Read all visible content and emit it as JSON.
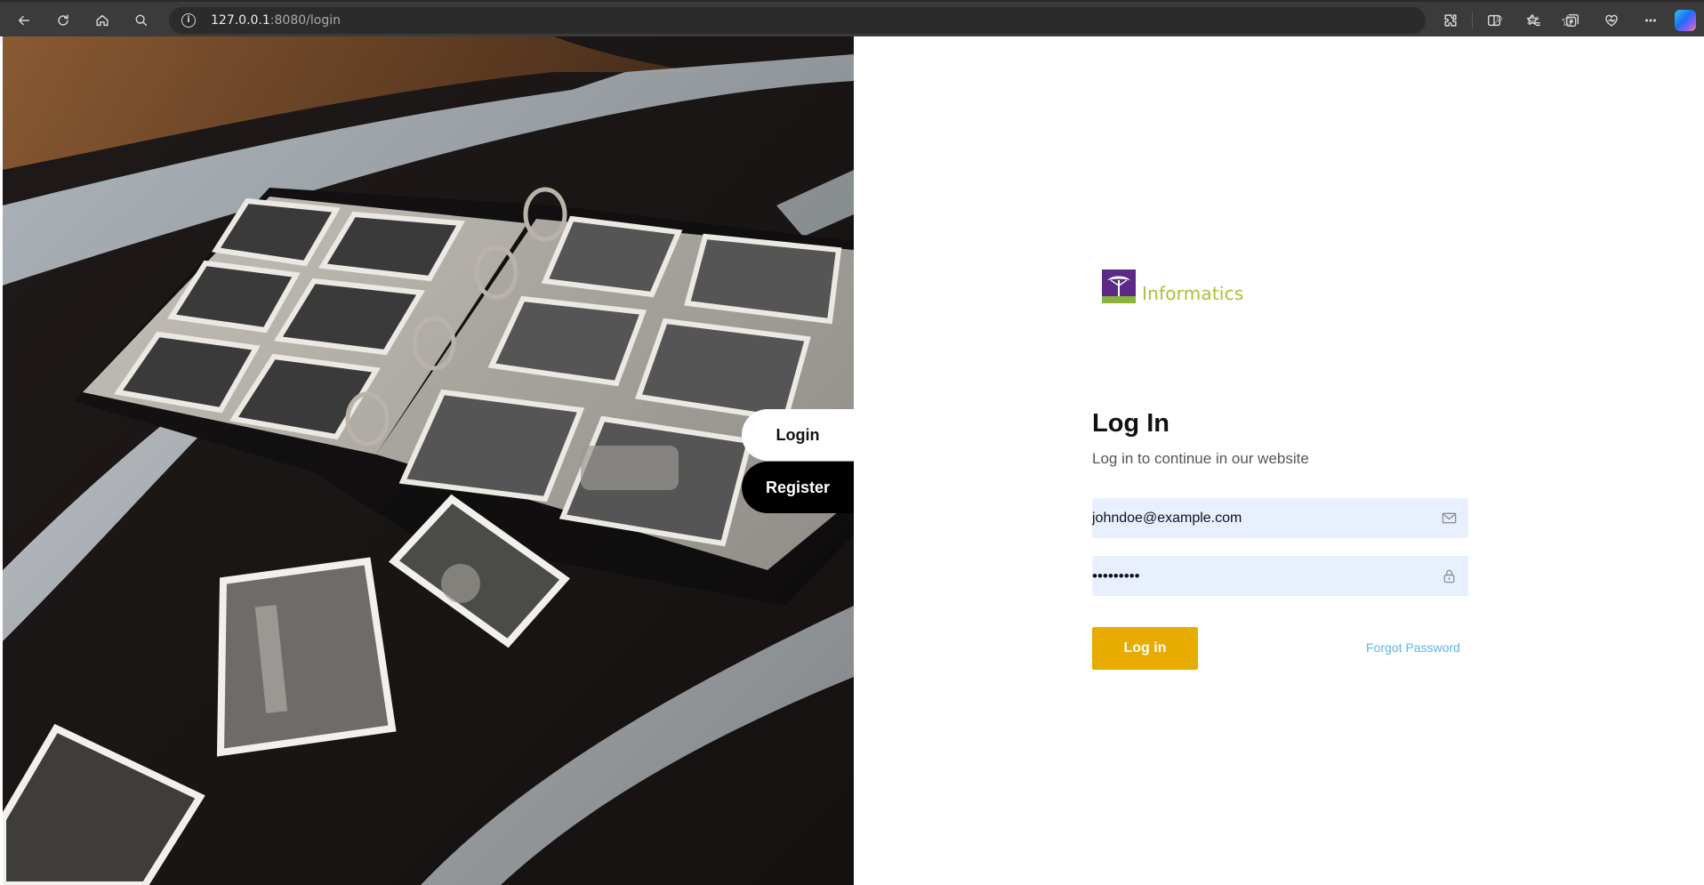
{
  "browser": {
    "url_host": "127.0.0.1",
    "url_rest": ":8080/login",
    "read_aloud_label": "Aᵃ"
  },
  "side_tabs": {
    "login_label": "Login",
    "register_label": "Register"
  },
  "brand": {
    "name": "Informatics",
    "color": "#a5c23a",
    "mark_color": "#5b2a86"
  },
  "form": {
    "title": "Log In",
    "subtitle": "Log in to continue in our website",
    "email_value": "johndoe@example.com",
    "password_value": "•••••••••",
    "submit_label": "Log in",
    "forgot_label": "Forgot Password",
    "accent_color": "#e8ab00",
    "link_color": "#5ab4ea",
    "field_bg": "#e8f0fe"
  },
  "icons": {
    "email_field": "mail-icon",
    "password_field": "lock-icon"
  }
}
